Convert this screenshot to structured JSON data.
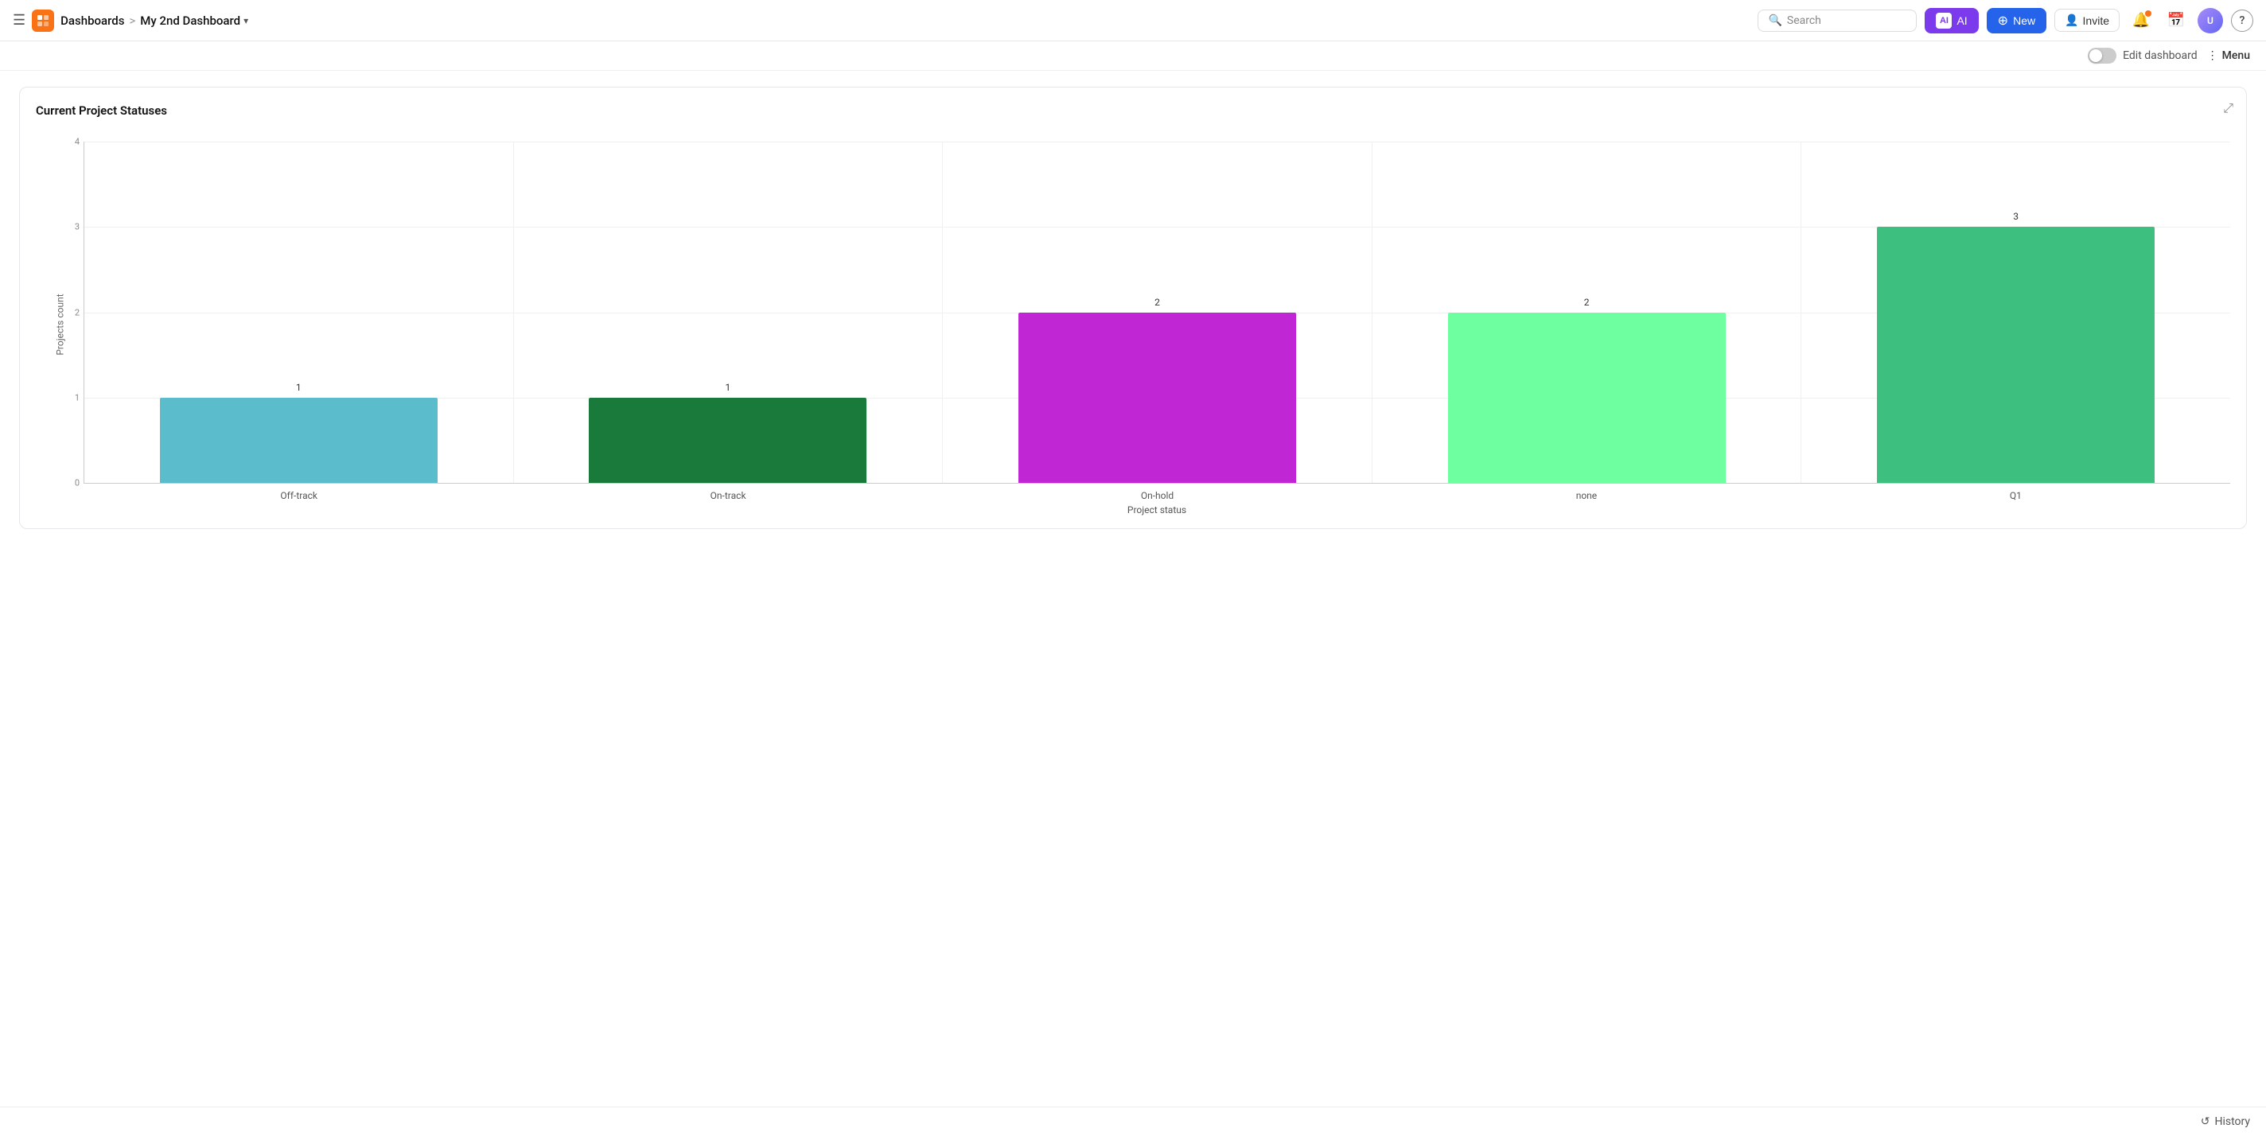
{
  "topnav": {
    "app_name": "Dashboards",
    "breadcrumb_sep": ">",
    "current_page": "My 2nd Dashboard",
    "search_placeholder": "Search",
    "ai_label": "AI",
    "new_label": "New",
    "invite_label": "Invite",
    "help_label": "?"
  },
  "secondary_bar": {
    "edit_label": "Edit dashboard",
    "menu_label": "Menu"
  },
  "chart": {
    "title": "Current Project Statuses",
    "y_axis_label": "Projects count",
    "x_axis_label": "Project status",
    "y_max": 4,
    "bars": [
      {
        "label": "Off-track",
        "value": 1,
        "color": "#5bbccc"
      },
      {
        "label": "On-track",
        "value": 1,
        "color": "#1a7a3c"
      },
      {
        "label": "On-hold",
        "value": 2,
        "color": "#c026d3"
      },
      {
        "label": "none",
        "value": 2,
        "color": "#6effa0"
      },
      {
        "label": "Q1",
        "value": 3,
        "color": "#3dbf80"
      }
    ],
    "y_ticks": [
      0,
      1,
      2,
      3,
      4
    ]
  },
  "bottom": {
    "history_label": "History"
  }
}
